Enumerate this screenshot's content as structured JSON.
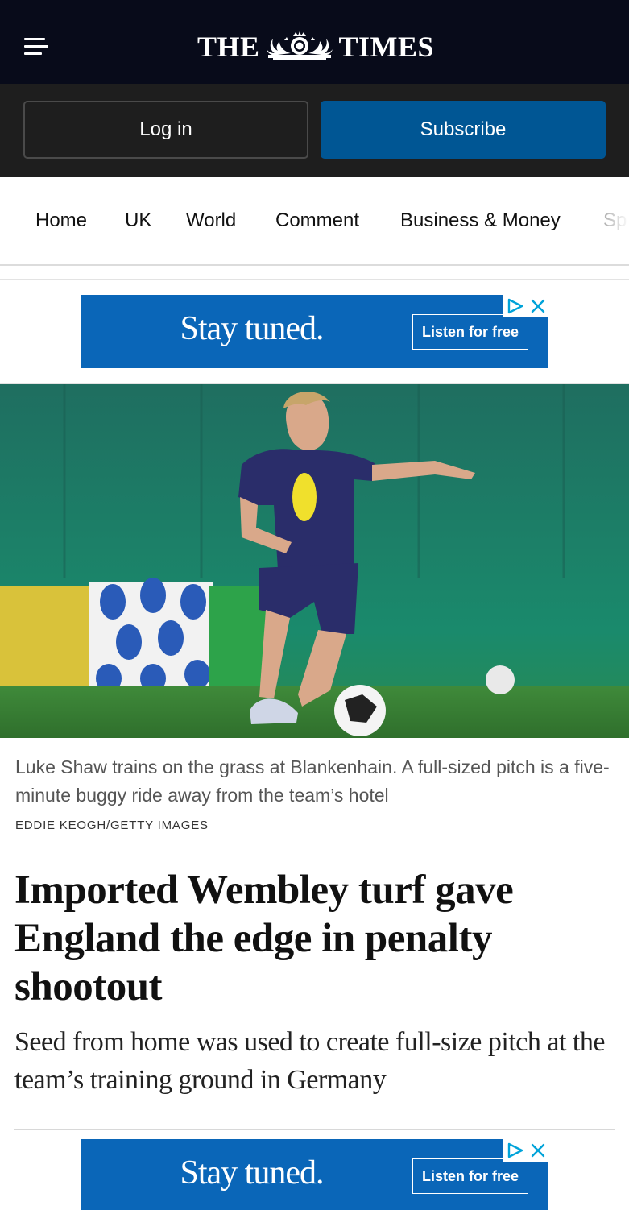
{
  "header": {
    "masthead_left": "THE",
    "masthead_right": "TIMES",
    "menu_icon": "hamburger-menu-icon",
    "background": "#080b1a"
  },
  "auth": {
    "login_label": "Log in",
    "subscribe_label": "Subscribe",
    "subscribe_color": "#005694"
  },
  "nav": {
    "items": [
      {
        "label": "Home"
      },
      {
        "label": "UK"
      },
      {
        "label": "World"
      },
      {
        "label": "Comment"
      },
      {
        "label": "Business & Money"
      },
      {
        "label": "Sp"
      }
    ]
  },
  "ads": [
    {
      "headline": "Stay tuned.",
      "cta": "Listen for free",
      "choices_icons": [
        "adchoices-icon",
        "close-icon"
      ],
      "color": "#0a66b8"
    },
    {
      "headline": "Stay tuned.",
      "cta": "Listen for free",
      "choices_icons": [
        "adchoices-icon",
        "close-icon"
      ],
      "color": "#0a66b8"
    }
  ],
  "article": {
    "image_alt": "Luke Shaw kicking a football during England training",
    "caption": "Luke Shaw trains on the grass at Blankenhain. A full-sized pitch is a five-minute buggy ride away from the team’s hotel",
    "credit": "EDDIE KEOGH/GETTY IMAGES",
    "headline": "Imported Wembley turf gave England the edge in penalty shootout",
    "standfirst": "Seed from home was used to create full-size pitch at the team’s training ground in Germany"
  }
}
